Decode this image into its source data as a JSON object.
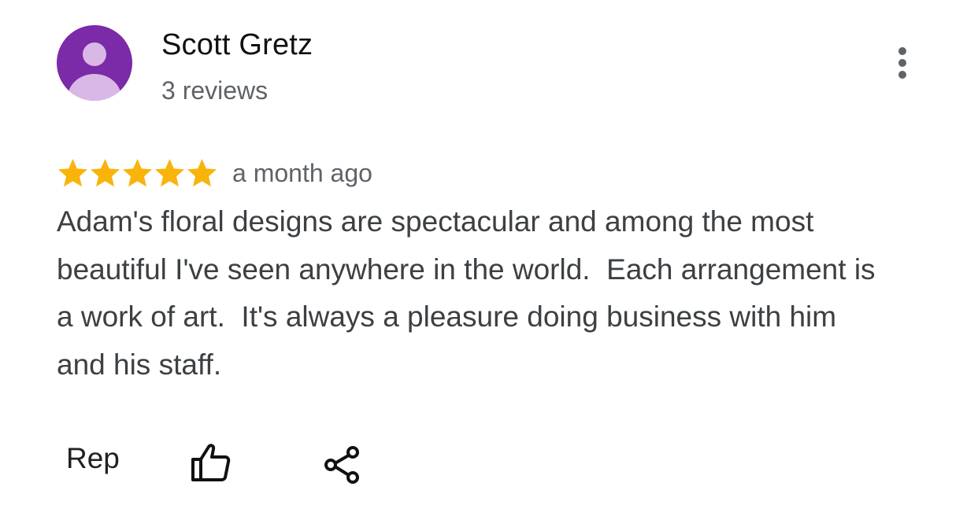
{
  "review": {
    "author": {
      "name": "Scott Gretz",
      "review_count": "3 reviews",
      "avatar_color": "#7b2aa8",
      "avatar_icon": "person-silhouette-icon"
    },
    "more_icon": "more-vertical-icon",
    "rating": {
      "stars": 5,
      "max": 5,
      "star_color": "#f9b40b"
    },
    "time_ago": "a month ago",
    "text": "Adam's floral designs are spectacular and among the most beautiful I've seen anywhere in the world.  Each arrangement is a work of art.  It's always a pleasure doing business with him and his staff.",
    "actions": {
      "reply_label": "Rep",
      "like_icon": "thumbs-up-icon",
      "share_icon": "share-icon"
    }
  }
}
